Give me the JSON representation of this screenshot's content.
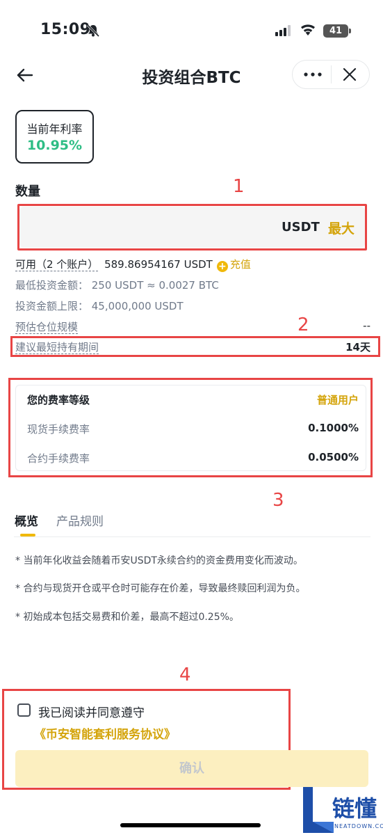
{
  "status_bar": {
    "time": "15:09",
    "battery": "41"
  },
  "header": {
    "title": "投资组合BTC"
  },
  "rate": {
    "label": "当前年利率",
    "value": "10.95%"
  },
  "amount": {
    "section_label": "数量",
    "input_value": "",
    "unit": "USDT",
    "max_label": "最大"
  },
  "info": {
    "available_label": "可用（2 个账户）",
    "available_value": "589.86954167 USDT",
    "recharge_label": "充值",
    "min_invest": "最低投资金额： 250 USDT ≈ 0.0027 BTC",
    "max_invest": "投资金额上限： 45,000,000 USDT",
    "position_scale_label": "预估仓位规模",
    "position_scale_value": "--",
    "min_hold_label": "建议最短持有期间",
    "min_hold_value": "14天"
  },
  "fees": {
    "level_label": "您的费率等级",
    "level_value": "普通用户",
    "spot_label": "现货手续费率",
    "spot_value": "0.1000%",
    "contract_label": "合约手续费率",
    "contract_value": "0.0500%"
  },
  "tabs": [
    {
      "label": "概览",
      "active": true
    },
    {
      "label": "产品规则",
      "active": false
    }
  ],
  "notes": [
    "* 当前年化收益会随着币安USDT永续合约的资金费用变化而波动。",
    "* 合约与现货开仓或平仓时可能存在价差，导致最终赎回利润为负。",
    "* 初始成本包括交易费和价差，最高不超过0.25%。"
  ],
  "agreement": {
    "text": "我已阅读并同意遵守",
    "link": "《币安智能套利服务协议》",
    "checked": false
  },
  "confirm_label": "确认",
  "annotations": [
    "1",
    "2",
    "3",
    "4"
  ],
  "watermark": {
    "text": "链懂",
    "sub": "NEATDOWN.COM"
  },
  "colors": {
    "accent": "#f0b90b",
    "link": "#d4a40b",
    "green": "#2ebd85",
    "annotation_red": "#e84545"
  }
}
